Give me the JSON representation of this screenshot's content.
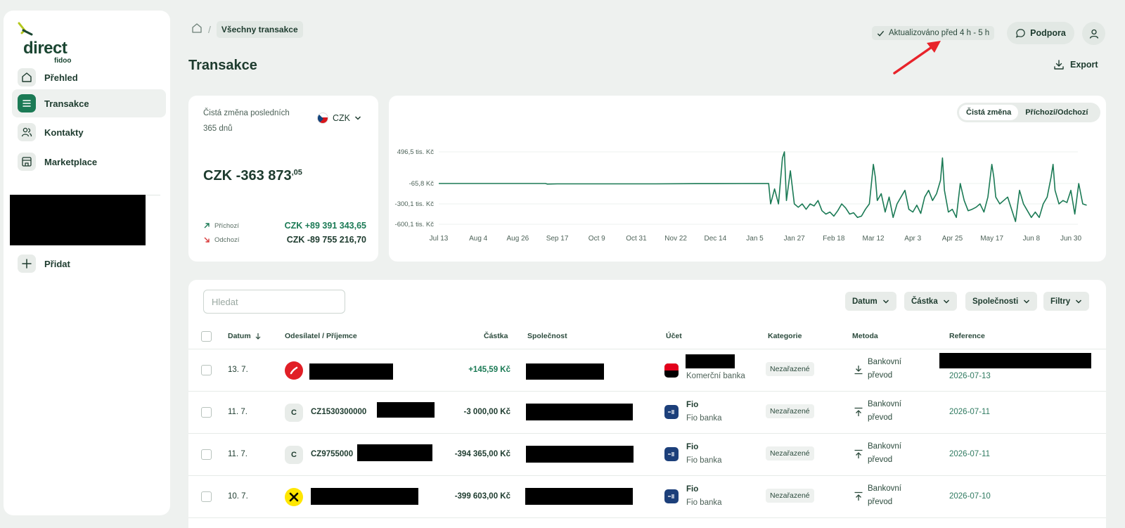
{
  "brand": {
    "name": "direct",
    "sub": "fidoo"
  },
  "sidebar": {
    "items": [
      {
        "label": "Přehled"
      },
      {
        "label": "Transakce"
      },
      {
        "label": "Kontakty"
      },
      {
        "label": "Marketplace"
      }
    ],
    "add_label": "Přidat"
  },
  "breadcrumb": {
    "current": "Všechny transakce"
  },
  "header": {
    "updated": "Aktualizováno před 4 h - 5 h",
    "support": "Podpora"
  },
  "page": {
    "title": "Transakce",
    "export": "Export"
  },
  "summary": {
    "label": "Čistá změna posledních 365 dnů",
    "currency": "CZK",
    "net_main": "CZK -363 873",
    "net_decimals": ",05",
    "incoming_label": "Příchozí",
    "incoming_value": "CZK +89 391 343,65",
    "outgoing_label": "Odchozí",
    "outgoing_value": "CZK -89 755 216,70"
  },
  "chart_toggle": {
    "options": [
      "Čistá změna",
      "Příchozí/Odchozí"
    ],
    "active": "Čistá změna"
  },
  "chart_data": {
    "type": "line",
    "title": "",
    "xlabel": "",
    "ylabel": "",
    "y_ticks": [
      {
        "label": "496,5 tis. Kč",
        "value": 496.5
      },
      {
        "label": "-65,8 Kč",
        "value": -0.0658
      },
      {
        "label": "-300,1 tis. Kč",
        "value": -300.1
      },
      {
        "label": "-600,1 tis. Kč",
        "value": -600.1
      }
    ],
    "x_ticks": [
      "Jul 13",
      "Aug 4",
      "Aug 26",
      "Sep 17",
      "Oct 9",
      "Oct 31",
      "Nov 22",
      "Dec 14",
      "Jan 5",
      "Jan 27",
      "Feb 18",
      "Mar 12",
      "Apr 3",
      "Apr 25",
      "May 17",
      "Jun 8",
      "Jun 30"
    ],
    "ylim": [
      -600.1,
      496.5
    ],
    "color": "#1b7a55",
    "series": [
      {
        "values": [
          [
            0,
            0
          ],
          [
            2.7,
            0
          ],
          [
            2.75,
            -8
          ],
          [
            3,
            -5
          ],
          [
            5.5,
            -5
          ],
          [
            6.5,
            -2
          ],
          [
            8.35,
            0
          ],
          [
            8.4,
            -300
          ],
          [
            8.5,
            -80
          ],
          [
            8.6,
            -300
          ],
          [
            8.7,
            400
          ],
          [
            8.75,
            496
          ],
          [
            8.8,
            -250
          ],
          [
            8.9,
            200
          ],
          [
            9.0,
            -300
          ],
          [
            9.1,
            -350
          ],
          [
            9.2,
            -300
          ],
          [
            9.3,
            -380
          ],
          [
            9.4,
            -300
          ],
          [
            9.5,
            -330
          ],
          [
            9.6,
            -250
          ],
          [
            9.7,
            -400
          ],
          [
            9.8,
            -450
          ],
          [
            9.9,
            -420
          ],
          [
            10.0,
            -480
          ],
          [
            10.1,
            -400
          ],
          [
            10.2,
            -300
          ],
          [
            10.3,
            -360
          ],
          [
            10.4,
            -450
          ],
          [
            10.5,
            -430
          ],
          [
            10.6,
            -500
          ],
          [
            10.7,
            -480
          ],
          [
            10.8,
            -380
          ],
          [
            10.9,
            -300
          ],
          [
            11.0,
            300
          ],
          [
            11.05,
            100
          ],
          [
            11.1,
            -250
          ],
          [
            11.2,
            -150
          ],
          [
            11.3,
            -420
          ],
          [
            11.4,
            -200
          ],
          [
            11.5,
            -500
          ],
          [
            11.6,
            -300
          ],
          [
            11.7,
            -200
          ],
          [
            11.8,
            -100
          ],
          [
            11.9,
            -380
          ],
          [
            12.0,
            -420
          ],
          [
            12.1,
            -320
          ],
          [
            12.2,
            -440
          ],
          [
            12.3,
            -200
          ],
          [
            12.4,
            -100
          ],
          [
            12.5,
            -250
          ],
          [
            12.6,
            -150
          ],
          [
            12.7,
            50
          ],
          [
            12.75,
            400
          ],
          [
            12.8,
            -100
          ],
          [
            12.9,
            -420
          ],
          [
            13.0,
            -380
          ],
          [
            13.1,
            -500
          ],
          [
            13.2,
            0
          ],
          [
            13.3,
            -250
          ],
          [
            13.4,
            -400
          ],
          [
            13.5,
            -380
          ],
          [
            13.6,
            -350
          ],
          [
            13.7,
            -300
          ],
          [
            13.8,
            -420
          ],
          [
            13.9,
            -200
          ],
          [
            14.0,
            300
          ],
          [
            14.05,
            100
          ],
          [
            14.1,
            -200
          ],
          [
            14.2,
            -300
          ],
          [
            14.3,
            -250
          ],
          [
            14.4,
            -200
          ],
          [
            14.5,
            -380
          ],
          [
            14.6,
            -560
          ],
          [
            14.7,
            -100
          ],
          [
            14.8,
            -300
          ],
          [
            14.9,
            -400
          ],
          [
            15.0,
            -500
          ],
          [
            15.1,
            -420
          ],
          [
            15.2,
            -500
          ],
          [
            15.3,
            -300
          ],
          [
            15.4,
            -200
          ],
          [
            15.5,
            100
          ],
          [
            15.55,
            300
          ],
          [
            15.6,
            -100
          ],
          [
            15.7,
            -300
          ],
          [
            15.8,
            -250
          ],
          [
            15.9,
            -280
          ],
          [
            16.0,
            -100
          ],
          [
            16.1,
            -450
          ],
          [
            16.2,
            0
          ],
          [
            16.3,
            -300
          ],
          [
            16.4,
            -320
          ]
        ]
      }
    ]
  },
  "transactions": {
    "search_placeholder": "Hledat",
    "filters": [
      "Datum",
      "Částka",
      "Společnosti",
      "Filtry"
    ],
    "headers": [
      "Datum",
      "Odesílatel / Příjemce",
      "Částka",
      "Společnost",
      "Účet",
      "Kategorie",
      "Metoda",
      "Reference"
    ],
    "rows": [
      {
        "date": "13. 7.",
        "sender": "",
        "amount": "+145,59 Kč",
        "account_name": "",
        "account_bank": "Komerční banka",
        "category": "Nezařazené",
        "method": "Bankovní převod",
        "reference": "2026-07-13"
      },
      {
        "date": "11. 7.",
        "sender": "CZ1530300000",
        "amount": "-3 000,00 Kč",
        "account_name": "Fio",
        "account_bank": "Fio banka",
        "category": "Nezařazené",
        "method": "Bankovní převod",
        "reference": "2026-07-11"
      },
      {
        "date": "11. 7.",
        "sender": "CZ9755000",
        "amount": "-394 365,00 Kč",
        "account_name": "Fio",
        "account_bank": "Fio banka",
        "category": "Nezařazené",
        "method": "Bankovní převod",
        "reference": "2026-07-11"
      },
      {
        "date": "10. 7.",
        "sender": "",
        "amount": "-399 603,00 Kč",
        "account_name": "Fio",
        "account_bank": "Fio banka",
        "category": "Nezařazené",
        "method": "Bankovní převod",
        "reference": "2026-07-10"
      }
    ],
    "sender_letters": [
      "",
      "C",
      "C",
      ""
    ]
  },
  "colors": {
    "accent": "#1b7a55",
    "positive": "#1b7a55",
    "negative": "#d93a3a",
    "annotation": "#e8232a"
  }
}
